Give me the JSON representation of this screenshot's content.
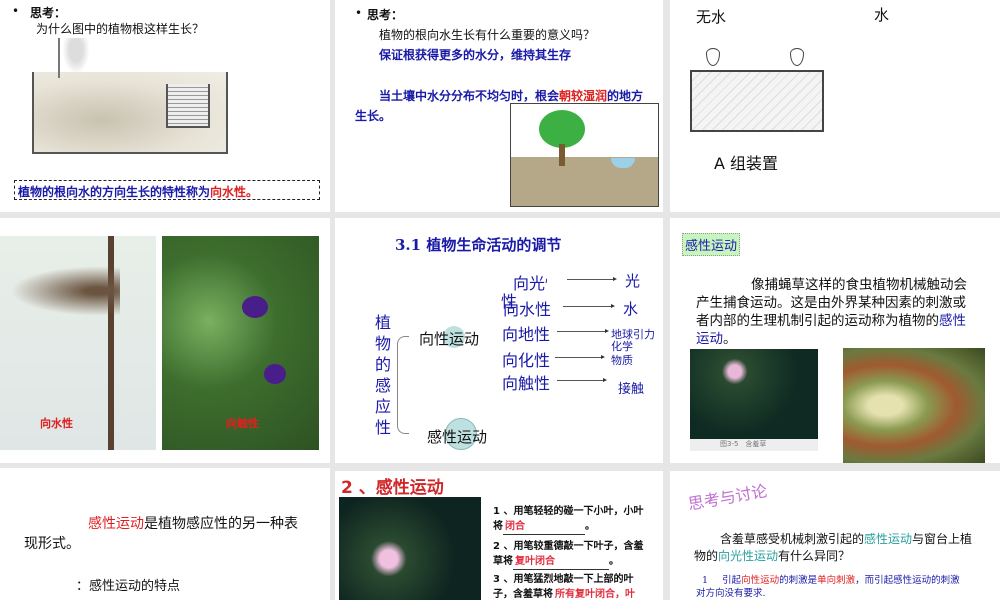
{
  "slides": [
    {
      "bullet": "•",
      "title": "思考：",
      "question": "为什么图中的植物根这样生长？",
      "definition": "植物的根向水的方向生长的特性称为",
      "definition_term": "向水性。"
    },
    {
      "bullet": "•",
      "title": "思考：",
      "question": "植物的根向水生长有什么重要的意义吗？",
      "answer": "保证根获得更多的水分，维持其生存",
      "text_1": "当土壤中水分分布不均匀时，根会",
      "text_highlight": "朝较湿润",
      "text_2": "的地方生长。"
    },
    {
      "label_left": "无水",
      "label_right": "水",
      "caption": "A 组装置"
    },
    {
      "label_1": "向水性",
      "label_2": "向触性"
    },
    {
      "title": "3.1 植物生命活动的调节",
      "root": "植物的感应性",
      "branch_1": "向性运动",
      "branch_2": "感性运动",
      "items": [
        {
          "name": "向光性",
          "target": "光"
        },
        {
          "name": "向水性",
          "target": "水"
        },
        {
          "name": "向地性",
          "target": "地球引力"
        },
        {
          "name": "向化性",
          "target": "化学物质"
        },
        {
          "name": "向触性",
          "target": "接触"
        }
      ],
      "stray": "性"
    },
    {
      "tag": "感性运动",
      "para_1": "像捕蝇草这样的食虫植物机械触动会产生捕食运动。这是由外界某种因素的刺激或者内部的生理机制引起的运动称为植物的",
      "para_term": "感性运动",
      "para_end": "。",
      "img_caption": "图3-5　含羞草"
    },
    {
      "term": "感性运动",
      "text": "是植物感应性的另一种表现形式。",
      "sub": "：感性运动的特点"
    },
    {
      "title": "2 、感性运动",
      "q1": "1 、用笔轻轻的碰一下小叶，小叶将",
      "a1": "闭合",
      "q2": "2 、用笔较重德敲一下叶子，含羞草将",
      "a2": "复叶闭合",
      "q3": "3 、用笔猛烈地敲一下上部的叶子，含羞草将",
      "a3": "所有复叶闭合，叶",
      "end": "。"
    },
    {
      "heading": "思考与讨论",
      "q_1": "含羞草感受机械刺激引起的",
      "q_term1": "感性运动",
      "q_2": "与窗台上植物的",
      "q_term2": "向光性运动",
      "q_3": "有什么异同？",
      "a_num": "1",
      "a_1": "引起",
      "a_term1": "向性运动",
      "a_2": "的刺激是",
      "a_term2": "单向刺激",
      "a_3": "，而引起感性运动的刺激对方向没有要求."
    }
  ]
}
